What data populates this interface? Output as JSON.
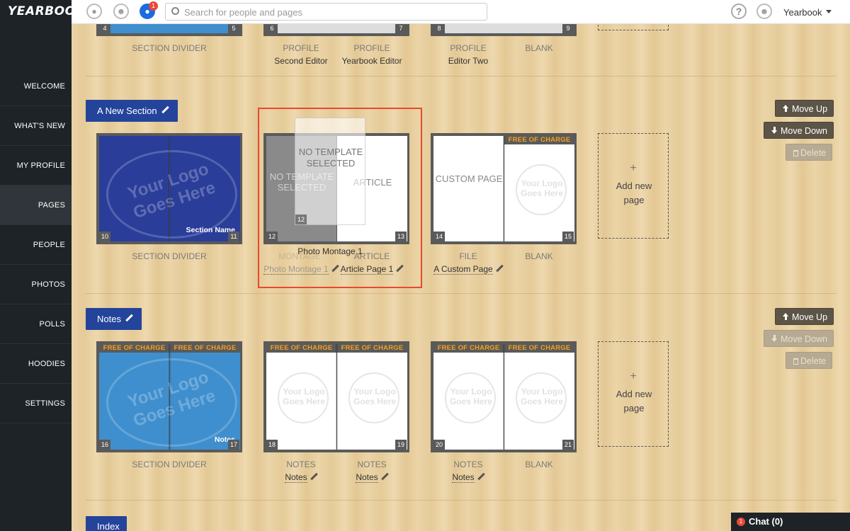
{
  "app": {
    "logo": "YEARBOOK",
    "account_name": "Yearbook",
    "notifications_count": "1"
  },
  "search": {
    "placeholder": "Search for people and pages"
  },
  "sidebar": {
    "items": [
      "WELCOME",
      "WHAT'S NEW",
      "MY PROFILE",
      "PAGES",
      "PEOPLE",
      "PHOTOS",
      "POLLS",
      "HOODIES",
      "SETTINGS"
    ],
    "active": "PAGES"
  },
  "top_row": {
    "pages": [
      {
        "num": "4",
        "label": "",
        "name": ""
      },
      {
        "num": "5",
        "label": "SECTION DIVIDER",
        "name": ""
      },
      {
        "num": "6",
        "label": "PROFILE",
        "name": "Second Editor"
      },
      {
        "num": "7",
        "label": "PROFILE",
        "name": "Yearbook Editor"
      },
      {
        "num": "8",
        "label": "PROFILE",
        "name": "Editor Two"
      },
      {
        "num": "9",
        "label": "BLANK",
        "name": ""
      }
    ]
  },
  "sections": [
    {
      "title": "A New Section",
      "move_up": "Move Up",
      "move_down": "Move Down",
      "delete": "Delete",
      "divider": {
        "text": "Section Name",
        "logo_text": "Your Logo Goes Here",
        "label": "SECTION DIVIDER",
        "left_num": "10",
        "right_num": "11"
      },
      "spread2": {
        "left_num": "12",
        "right_num": "13",
        "left_text": "NO TEMPLATE SELECTED",
        "right_text": "ARTICLE",
        "ghost_text": "NO TEMPLATE SELECTED",
        "ghost_num": "12",
        "left_label_ghost": "MONTAGE",
        "left_name": "Photo Montage 1",
        "right_label": "ARTICLE",
        "right_name": "Article Page 1",
        "drag_name": "Photo Montage 1"
      },
      "spread3": {
        "left_num": "14",
        "right_num": "15",
        "left_text": "CUSTOM PAGE",
        "free": "FREE OF CHARGE",
        "left_label": "FILE",
        "left_name": "A Custom Page",
        "right_label": "BLANK"
      },
      "add_page": {
        "plus": "+",
        "text": "Add new page"
      }
    },
    {
      "title": "Notes",
      "move_up": "Move Up",
      "move_down": "Move Down",
      "delete": "Delete",
      "divider": {
        "text": "Notes",
        "logo_text": "Your Logo Goes Here",
        "label": "SECTION DIVIDER",
        "free": "FREE OF CHARGE",
        "left_num": "16",
        "right_num": "17"
      },
      "spread2": {
        "free": "FREE OF CHARGE",
        "left_num": "18",
        "right_num": "19",
        "logo_text": "Your Logo Goes Here",
        "left_label": "NOTES",
        "left_name": "Notes",
        "right_label": "NOTES",
        "right_name": "Notes"
      },
      "spread3": {
        "free": "FREE OF CHARGE",
        "left_num": "20",
        "right_num": "21",
        "logo_text": "Your Logo Goes Here",
        "left_label": "NOTES",
        "left_name": "Notes",
        "right_label": "BLANK"
      },
      "add_page": {
        "plus": "+",
        "text": "Add new page"
      }
    }
  ],
  "index_section": {
    "title": "Index"
  },
  "chat": {
    "label": "Chat (0)",
    "count": "1"
  },
  "colors": {
    "sidebar": "#1e2327",
    "section_tag": "#23449a",
    "free_text": "#f7a11a",
    "drop_highlight": "#e84a2e"
  }
}
